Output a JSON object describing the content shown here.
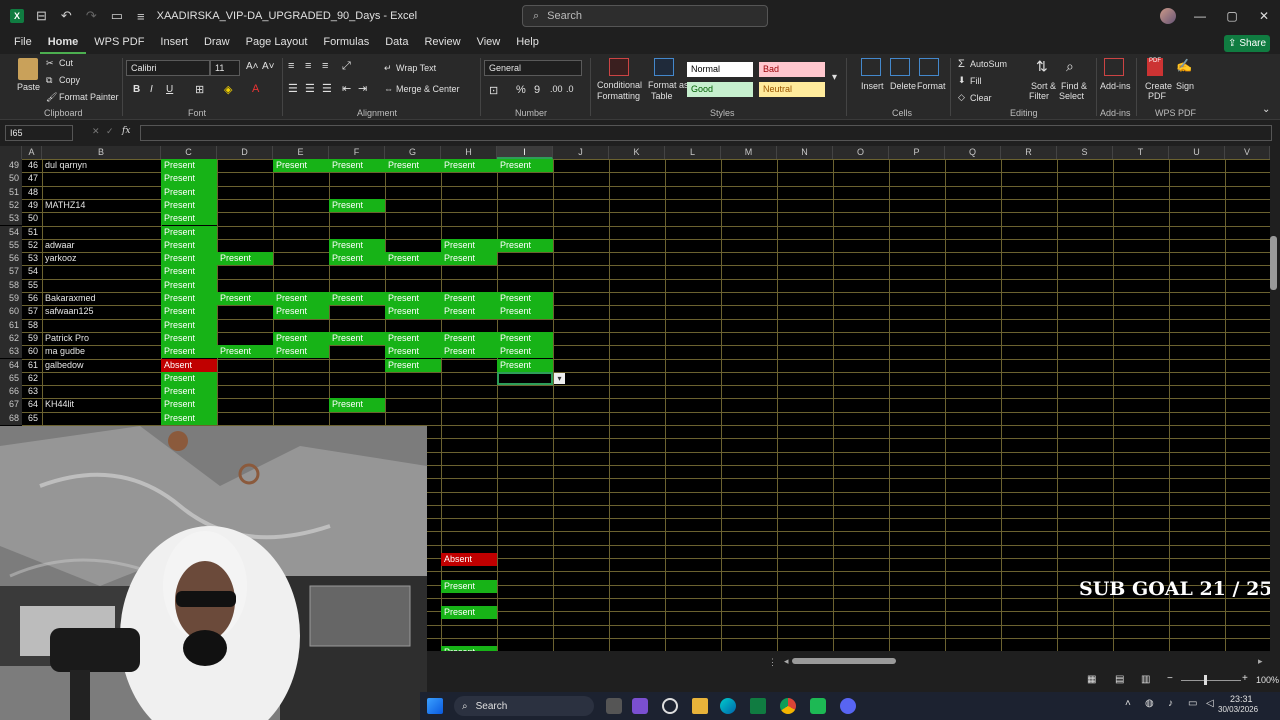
{
  "window": {
    "title": "XAADIRSKA_VIP-DA_UPGRADED_90_Days - Excel",
    "search_placeholder": "Search",
    "app_letter": "X"
  },
  "menu": {
    "tabs": [
      "File",
      "Home",
      "WPS PDF",
      "Insert",
      "Draw",
      "Page Layout",
      "Formulas",
      "Data",
      "Review",
      "View",
      "Help"
    ],
    "active": "Home",
    "share": "Share"
  },
  "ribbon": {
    "clipboard": {
      "paste": "Paste",
      "cut": "Cut",
      "copy": "Copy",
      "format_painter": "Format Painter",
      "label": "Clipboard"
    },
    "font": {
      "name": "Calibri",
      "size": "11",
      "label": "Font"
    },
    "alignment": {
      "wrap": "Wrap Text",
      "merge": "Merge & Center",
      "label": "Alignment"
    },
    "number": {
      "format": "General",
      "label": "Number"
    },
    "styles": {
      "conditional": "Conditional",
      "formatting": "Formatting",
      "format_as": "Format as",
      "table": "Table",
      "normal": "Normal",
      "bad": "Bad",
      "good": "Good",
      "neutral": "Neutral",
      "label": "Styles"
    },
    "cells": {
      "insert": "Insert",
      "delete": "Delete",
      "format": "Format",
      "label": "Cells"
    },
    "editing": {
      "autosum": "AutoSum",
      "fill": "Fill",
      "clear": "Clear",
      "sort": "Sort &",
      "filter": "Filter",
      "find": "Find &",
      "select": "Select",
      "label": "Editing"
    },
    "addins": {
      "addins": "Add-ins",
      "label": "Add-ins"
    },
    "wps": {
      "create": "Create",
      "pdf": "PDF",
      "sign": "Sign",
      "label": "WPS PDF"
    }
  },
  "formula_bar": {
    "name_box": "I65",
    "fx": "fx",
    "value": ""
  },
  "columns": [
    "A",
    "B",
    "C",
    "D",
    "E",
    "F",
    "G",
    "H",
    "I",
    "J",
    "K",
    "L",
    "M",
    "N",
    "O",
    "P",
    "Q",
    "R",
    "S",
    "T",
    "U",
    "V"
  ],
  "selected_column": "I",
  "rows": [
    {
      "r": "49",
      "a": "46",
      "b": "dul qarnyn",
      "c": "Present",
      "d": "",
      "e": "Present",
      "f": "Present",
      "g": "Present",
      "h": "Present",
      "i": "Present"
    },
    {
      "r": "50",
      "a": "47",
      "b": "",
      "c": "Present",
      "d": "",
      "e": "",
      "f": "",
      "g": "",
      "h": "",
      "i": ""
    },
    {
      "r": "51",
      "a": "48",
      "b": "",
      "c": "Present",
      "d": "",
      "e": "",
      "f": "",
      "g": "",
      "h": "",
      "i": ""
    },
    {
      "r": "52",
      "a": "49",
      "b": "MATHZ14",
      "c": "Present",
      "d": "",
      "e": "",
      "f": "Present",
      "g": "",
      "h": "",
      "i": ""
    },
    {
      "r": "53",
      "a": "50",
      "b": "",
      "c": "Present",
      "d": "",
      "e": "",
      "f": "",
      "g": "",
      "h": "",
      "i": ""
    },
    {
      "r": "54",
      "a": "51",
      "b": "",
      "c": "Present",
      "d": "",
      "e": "",
      "f": "",
      "g": "",
      "h": "",
      "i": ""
    },
    {
      "r": "55",
      "a": "52",
      "b": "adwaar",
      "c": "Present",
      "d": "",
      "e": "",
      "f": "Present",
      "g": "",
      "h": "Present",
      "i": "Present"
    },
    {
      "r": "56",
      "a": "53",
      "b": "yarkooz",
      "c": "Present",
      "d": "Present",
      "e": "",
      "f": "Present",
      "g": "Present",
      "h": "Present",
      "i": ""
    },
    {
      "r": "57",
      "a": "54",
      "b": "",
      "c": "Present",
      "d": "",
      "e": "",
      "f": "",
      "g": "",
      "h": "",
      "i": ""
    },
    {
      "r": "58",
      "a": "55",
      "b": "",
      "c": "Present",
      "d": "",
      "e": "",
      "f": "",
      "g": "",
      "h": "",
      "i": ""
    },
    {
      "r": "59",
      "a": "56",
      "b": "Bakaraxmed",
      "c": "Present",
      "d": "Present",
      "e": "Present",
      "f": "Present",
      "g": "Present",
      "h": "Present",
      "i": "Present"
    },
    {
      "r": "60",
      "a": "57",
      "b": "safwaan125",
      "c": "Present",
      "d": "",
      "e": "Present",
      "f": "",
      "g": "Present",
      "h": "Present",
      "i": "Present"
    },
    {
      "r": "61",
      "a": "58",
      "b": "",
      "c": "Present",
      "d": "",
      "e": "",
      "f": "",
      "g": "",
      "h": "",
      "i": ""
    },
    {
      "r": "62",
      "a": "59",
      "b": "Patrick Pro",
      "c": "Present",
      "d": "",
      "e": "Present",
      "f": "Present",
      "g": "Present",
      "h": "Present",
      "i": "Present"
    },
    {
      "r": "63",
      "a": "60",
      "b": "ma gudbe",
      "c": "Present",
      "d": "Present",
      "e": "Present",
      "f": "",
      "g": "Present",
      "h": "Present",
      "i": "Present"
    },
    {
      "r": "64",
      "a": "61",
      "b": "galbedow",
      "c": "Absent",
      "d": "",
      "e": "",
      "f": "",
      "g": "Present",
      "h": "",
      "i": "Present"
    },
    {
      "r": "65",
      "a": "62",
      "b": "",
      "c": "Present",
      "d": "",
      "e": "",
      "f": "",
      "g": "",
      "h": "",
      "i": ""
    },
    {
      "r": "66",
      "a": "63",
      "b": "",
      "c": "Present",
      "d": "",
      "e": "",
      "f": "",
      "g": "",
      "h": "",
      "i": ""
    },
    {
      "r": "67",
      "a": "64",
      "b": "KH44lit",
      "c": "Present",
      "d": "",
      "e": "",
      "f": "Present",
      "g": "",
      "h": "",
      "i": ""
    },
    {
      "r": "68",
      "a": "65",
      "b": "",
      "c": "Present",
      "d": "",
      "e": "",
      "f": "",
      "g": "",
      "h": "",
      "i": ""
    }
  ],
  "lower_cells": [
    {
      "text": "Absent",
      "status": "absent"
    },
    {
      "text": "Present",
      "status": "present"
    },
    {
      "text": "Present",
      "status": "present"
    },
    {
      "text": "Present",
      "status": "present"
    }
  ],
  "overlay": {
    "sub_goal": "SUB GOAL 21 / 25"
  },
  "status": {
    "zoom": "100%"
  },
  "taskbar": {
    "search": "Search",
    "time": "23:31",
    "date": "30/03/2026"
  },
  "colors": {
    "present": "#17b317",
    "absent": "#c00000",
    "accent": "#107c41",
    "grid_line": "#6b6230"
  }
}
